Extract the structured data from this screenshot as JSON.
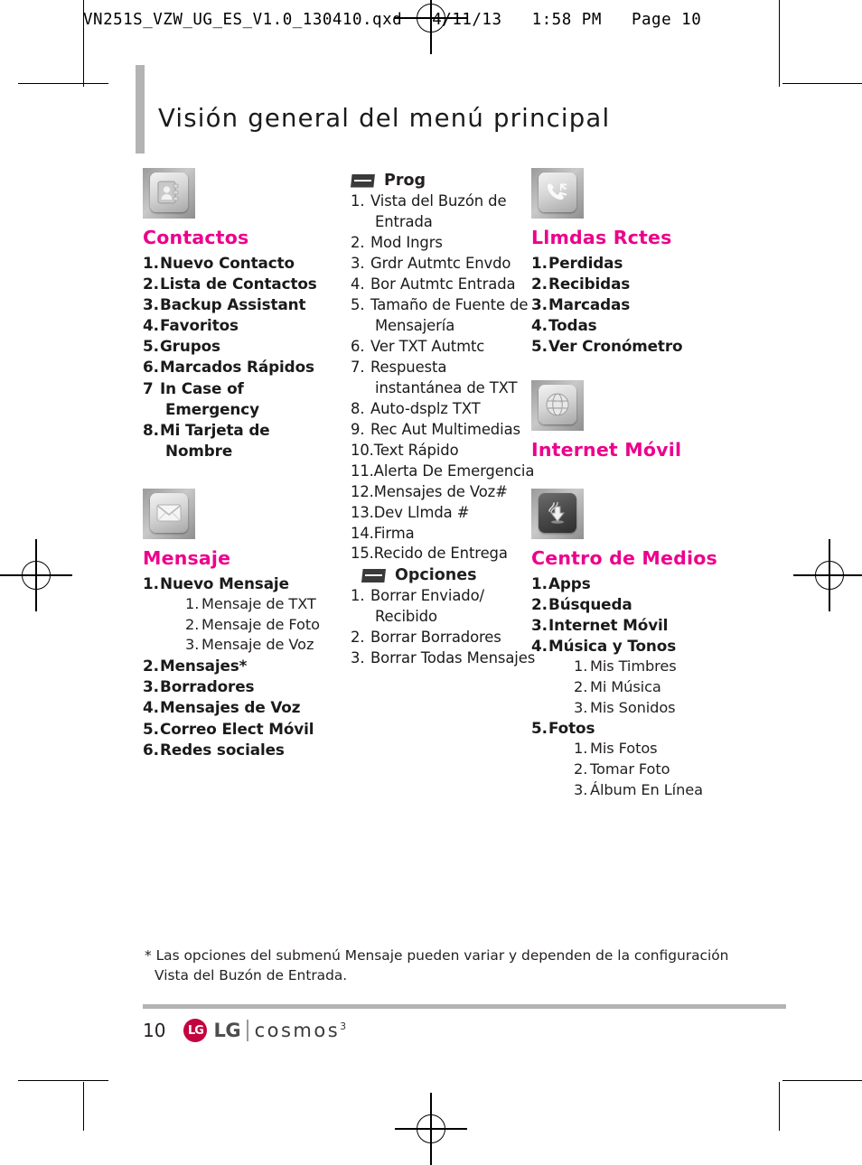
{
  "file_header": "VN251S_VZW_UG_ES_V1.0_130410.qxd   4/11/13   1:58 PM   Page 10",
  "page_title": "Visión general del menú principal",
  "accent_color": "#ec008c",
  "columns": {
    "left": [
      {
        "icon": "contacts-book-icon",
        "heading": "Contactos",
        "items": [
          {
            "num": "1.",
            "label": "Nuevo Contacto"
          },
          {
            "num": "2.",
            "label": "Lista de Contactos"
          },
          {
            "num": "3.",
            "label": "Backup Assistant"
          },
          {
            "num": "4.",
            "label": "Favoritos"
          },
          {
            "num": "5.",
            "label": "Grupos"
          },
          {
            "num": "6.",
            "label": "Marcados Rápidos"
          },
          {
            "num": "7",
            "label": "In Case of Emergency"
          },
          {
            "num": "8.",
            "label": "Mi Tarjeta de Nombre"
          }
        ]
      },
      {
        "icon": "envelope-icon",
        "heading": "Mensaje",
        "items": [
          {
            "num": "1.",
            "label": "Nuevo Mensaje",
            "sub": [
              {
                "num": "1.",
                "label": "Mensaje de TXT"
              },
              {
                "num": "2.",
                "label": "Mensaje de Foto"
              },
              {
                "num": "3.",
                "label": "Mensaje de Voz"
              }
            ]
          },
          {
            "num": "2.",
            "label": "Mensajes*"
          },
          {
            "num": "3.",
            "label": "Borradores"
          },
          {
            "num": "4.",
            "label": "Mensajes de Voz"
          },
          {
            "num": "5.",
            "label": "Correo Elect Móvil"
          },
          {
            "num": "6.",
            "label": "Redes sociales"
          }
        ]
      }
    ],
    "middle": [
      {
        "bullet": "slab-bullet-icon",
        "heading": "Prog",
        "items": [
          {
            "num": "1.",
            "label": "Vista del Buzón de Entrada"
          },
          {
            "num": "2.",
            "label": "Mod Ingrs"
          },
          {
            "num": "3.",
            "label": "Grdr Autmtc Envdo"
          },
          {
            "num": "4.",
            "label": "Bor Autmtc Entrada"
          },
          {
            "num": "5.",
            "label": "Tamaño de Fuente de Mensajería"
          },
          {
            "num": "6.",
            "label": "Ver TXT Autmtc"
          },
          {
            "num": "7.",
            "label": "Respuesta instantánea de TXT"
          },
          {
            "num": "8.",
            "label": "Auto-dsplz TXT"
          },
          {
            "num": "9.",
            "label": "Rec Aut Multimedias"
          },
          {
            "num": "10.",
            "label": "Text Rápido"
          },
          {
            "num": "11.",
            "label": "Alerta De Emergencia"
          },
          {
            "num": "12.",
            "label": "Mensajes de Voz#"
          },
          {
            "num": "13.",
            "label": "Dev Llmda #"
          },
          {
            "num": "14.",
            "label": "Firma"
          },
          {
            "num": "15.",
            "label": "Recido de Entrega"
          }
        ]
      },
      {
        "bullet": "slab-bullet-icon",
        "heading": "Opciones",
        "items": [
          {
            "num": "1.",
            "label": "Borrar Enviado/ Recibido"
          },
          {
            "num": "2.",
            "label": "Borrar Borradores"
          },
          {
            "num": "3.",
            "label": "Borrar Todas Mensajes"
          }
        ]
      }
    ],
    "right": [
      {
        "icon": "recent-calls-icon",
        "heading": "Llmdas Rctes",
        "items": [
          {
            "num": "1.",
            "label": "Perdidas"
          },
          {
            "num": "2.",
            "label": "Recibidas"
          },
          {
            "num": "3.",
            "label": "Marcadas"
          },
          {
            "num": "4.",
            "label": "Todas"
          },
          {
            "num": "5.",
            "label": "Ver Cronómetro"
          }
        ]
      },
      {
        "icon": "globe-icon",
        "heading": "Internet Móvil",
        "items": []
      },
      {
        "icon": "download-icon",
        "heading": "Centro de Medios",
        "items": [
          {
            "num": "1.",
            "label": "Apps"
          },
          {
            "num": "2.",
            "label": "Búsqueda"
          },
          {
            "num": "3.",
            "label": "Internet Móvil"
          },
          {
            "num": "4.",
            "label": "Música y Tonos",
            "sub": [
              {
                "num": "1.",
                "label": "Mis Timbres"
              },
              {
                "num": "2.",
                "label": "Mi Música"
              },
              {
                "num": "3.",
                "label": "Mis Sonidos"
              }
            ]
          },
          {
            "num": "5.",
            "label": "Fotos",
            "sub": [
              {
                "num": "1.",
                "label": "Mis Fotos"
              },
              {
                "num": "2.",
                "label": "Tomar Foto"
              },
              {
                "num": "3.",
                "label": "Álbum En Línea"
              }
            ]
          }
        ]
      }
    ]
  },
  "footnote": "* Las opciones del submenú Mensaje pueden variar y dependen de la configuración Vista del Buzón de Entrada.",
  "footer": {
    "page_number": "10",
    "brand": "LG",
    "product": "cosmos",
    "product_sup": "3"
  }
}
